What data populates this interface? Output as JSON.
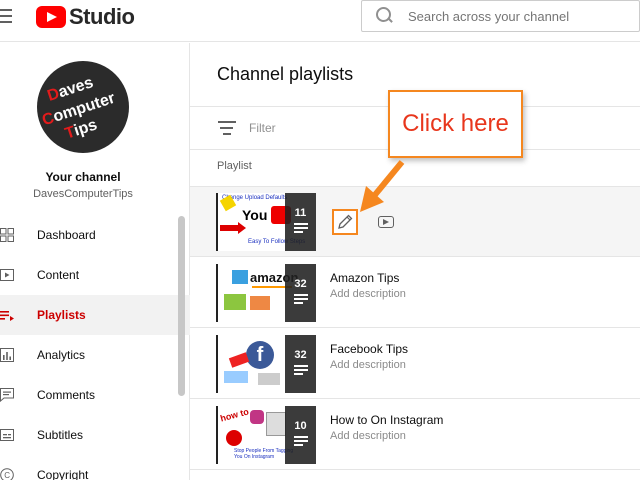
{
  "header": {
    "logo_text": "Studio",
    "search_placeholder": "Search across your channel"
  },
  "sidebar": {
    "avatar_lines": [
      "Daves",
      "Computer",
      "Tips"
    ],
    "your_channel_label": "Your channel",
    "channel_handle": "DavesComputerTips",
    "items": [
      {
        "label": "Dashboard",
        "icon": "dashboard-icon",
        "active": false
      },
      {
        "label": "Content",
        "icon": "content-icon",
        "active": false
      },
      {
        "label": "Playlists",
        "icon": "playlists-icon",
        "active": true
      },
      {
        "label": "Analytics",
        "icon": "analytics-icon",
        "active": false
      },
      {
        "label": "Comments",
        "icon": "comments-icon",
        "active": false
      },
      {
        "label": "Subtitles",
        "icon": "subtitles-icon",
        "active": false
      },
      {
        "label": "Copyright",
        "icon": "copyright-icon",
        "active": false
      }
    ]
  },
  "main": {
    "page_title": "Channel playlists",
    "filter_label": "Filter",
    "column_header": "Playlist",
    "playlists": [
      {
        "title": "",
        "description": "",
        "count": "11",
        "thumb_caption": "Change Upload Defaults",
        "thumb_subcaption": "Easy To Follow Steps"
      },
      {
        "title": "Amazon Tips",
        "description": "Add description",
        "count": "32",
        "thumb_caption": "amazon"
      },
      {
        "title": "Facebook Tips",
        "description": "Add description",
        "count": "32",
        "thumb_caption": "f"
      },
      {
        "title": "How to On Instagram",
        "description": "Add description",
        "count": "10",
        "thumb_caption": "Stop People From Tagging You On Instagram"
      }
    ]
  },
  "callout": {
    "text": "Click here"
  },
  "colors": {
    "accent_red": "#cc0000",
    "callout_border": "#f5871f",
    "callout_text": "#e8361c"
  }
}
